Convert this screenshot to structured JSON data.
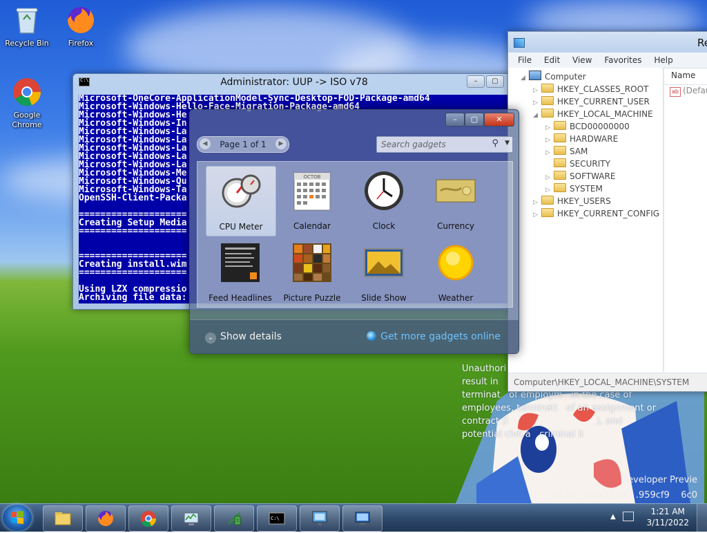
{
  "desktop": {
    "icons": [
      {
        "label": "Recycle Bin",
        "icon": "recycle-bin-icon"
      },
      {
        "label": "Firefox",
        "icon": "firefox-icon"
      },
      {
        "label": "Google Chrome",
        "icon": "chrome-icon"
      }
    ]
  },
  "console": {
    "title": "Administrator:  UUP -> ISO v78",
    "lines": [
      "Microsoft-OneCore-ApplicationModel-Sync-Desktop-FOD-Package-amd64",
      "Microsoft-Windows-Hello-Face-Migration-Package-amd64",
      "Microsoft-Windows-He",
      "Microsoft-Windows-In",
      "Microsoft-Windows-La",
      "Microsoft-Windows-La",
      "Microsoft-Windows-La",
      "Microsoft-Windows-La",
      "Microsoft-Windows-La",
      "Microsoft-Windows-Me",
      "Microsoft-Windows-Qu",
      "Microsoft-Windows-Ta",
      "OpenSSH-Client-Packa",
      "",
      "====================",
      "Creating Setup Media",
      "====================",
      "",
      "",
      "====================",
      "Creating install.wim",
      "====================",
      "",
      "Using LZX compressio",
      "Archiving file data:"
    ]
  },
  "regedit": {
    "title": "Re",
    "menu": [
      "File",
      "Edit",
      "View",
      "Favorites",
      "Help"
    ],
    "tree": [
      {
        "label": "Computer",
        "depth": 0,
        "arrow": "◢",
        "kind": "pc"
      },
      {
        "label": "HKEY_CLASSES_ROOT",
        "depth": 1,
        "arrow": "▷",
        "kind": "folder"
      },
      {
        "label": "HKEY_CURRENT_USER",
        "depth": 1,
        "arrow": "▷",
        "kind": "folder"
      },
      {
        "label": "HKEY_LOCAL_MACHINE",
        "depth": 1,
        "arrow": "◢",
        "kind": "folder"
      },
      {
        "label": "BCD00000000",
        "depth": 2,
        "arrow": "▷",
        "kind": "folder"
      },
      {
        "label": "HARDWARE",
        "depth": 2,
        "arrow": "▷",
        "kind": "folder"
      },
      {
        "label": "SAM",
        "depth": 2,
        "arrow": "▷",
        "kind": "folder"
      },
      {
        "label": "SECURITY",
        "depth": 2,
        "arrow": "",
        "kind": "folder"
      },
      {
        "label": "SOFTWARE",
        "depth": 2,
        "arrow": "▷",
        "kind": "folder"
      },
      {
        "label": "SYSTEM",
        "depth": 2,
        "arrow": "▷",
        "kind": "folder"
      },
      {
        "label": "HKEY_USERS",
        "depth": 1,
        "arrow": "▷",
        "kind": "folder"
      },
      {
        "label": "HKEY_CURRENT_CONFIG",
        "depth": 1,
        "arrow": "▷",
        "kind": "folder"
      }
    ],
    "name_header": "Name",
    "default_value": "(Defaul",
    "status": "Computer\\HKEY_LOCAL_MACHINE\\SYSTEM"
  },
  "gadgets": {
    "page_label": "Page 1 of 1",
    "search_placeholder": "Search gadgets",
    "items": [
      {
        "label": "CPU Meter",
        "icon": "cpu-meter-icon",
        "selected": true
      },
      {
        "label": "Calendar",
        "icon": "calendar-icon",
        "selected": false
      },
      {
        "label": "Clock",
        "icon": "clock-icon",
        "selected": false
      },
      {
        "label": "Currency",
        "icon": "currency-icon",
        "selected": false
      },
      {
        "label": "Feed Headlines",
        "icon": "feed-headlines-icon",
        "selected": false
      },
      {
        "label": "Picture Puzzle",
        "icon": "picture-puzzle-icon",
        "selected": false
      },
      {
        "label": "Slide Show",
        "icon": "slide-show-icon",
        "selected": false
      },
      {
        "label": "Weather",
        "icon": "weather-icon",
        "selected": false
      }
    ],
    "show_details": "Show details",
    "get_more": "Get more gadgets online",
    "calendar_month": "OCTOB"
  },
  "notice": {
    "lines": [
      "Unauthori",
      "result in",
      "terminat   of employm   in the case of",
      "employees, terminati   of an assignment or",
      "contract (i                               ), and",
      "potential civil a   criminal li"
    ]
  },
  "build": {
    "line1": "Developer Previe",
    "line2": "64.fbl   eap.1108   .959cf9    6c0"
  },
  "taskbar": {
    "apps": [
      "explorer-icon",
      "firefox-icon",
      "chrome-icon",
      "task-manager-icon",
      "uup-tool-icon",
      "cmd-icon",
      "network-icon",
      "remote-desktop-icon"
    ],
    "time": "1:21 AM",
    "date": "3/11/2022"
  },
  "colors": {
    "console_bg": "#0000a8",
    "link": "#6fc2ff",
    "close": "#c5331b"
  }
}
